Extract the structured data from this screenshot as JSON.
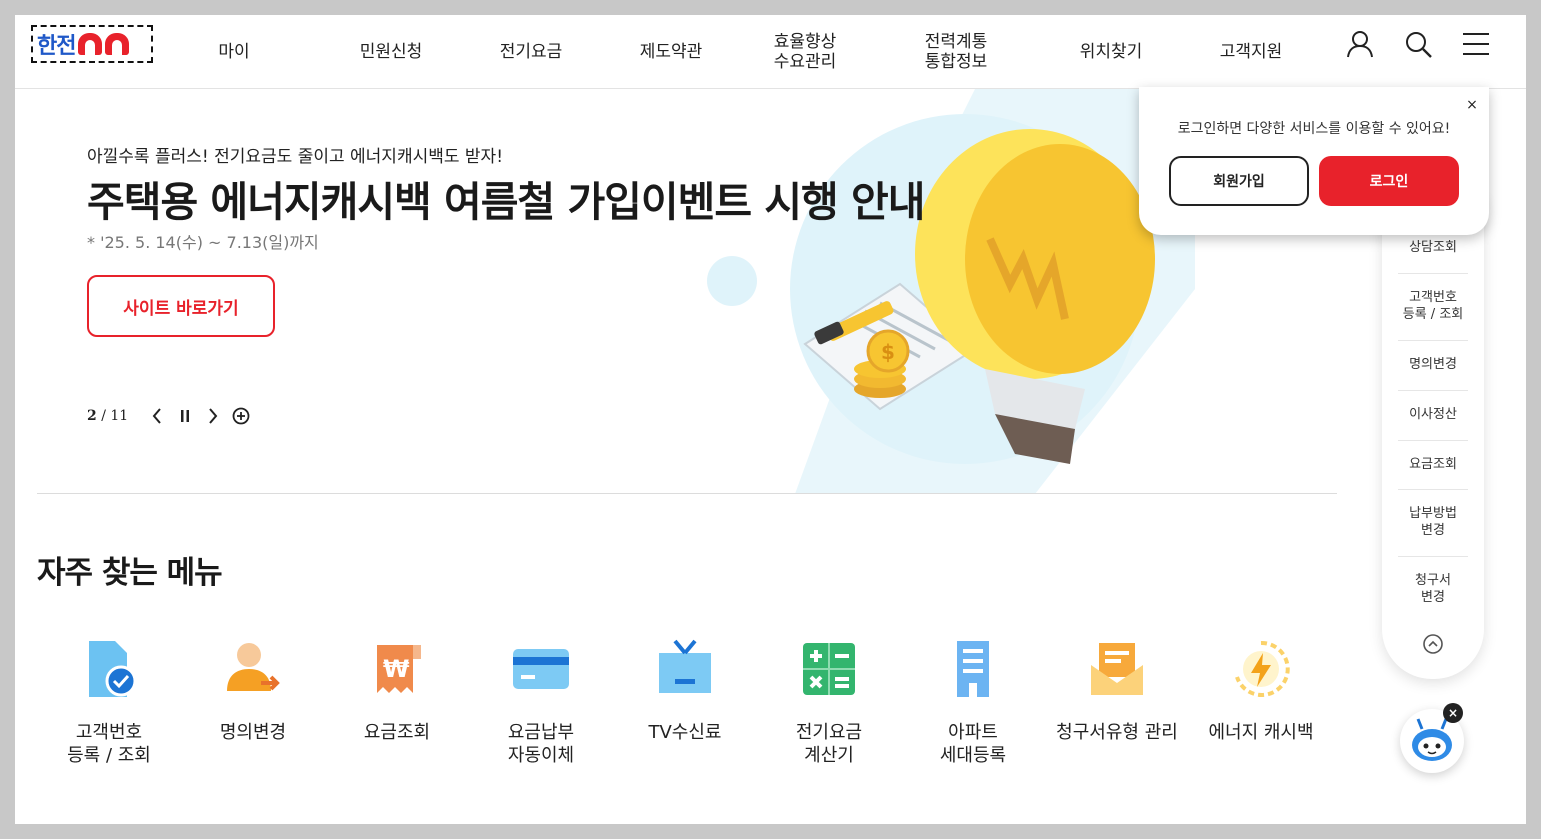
{
  "header": {
    "nav": [
      {
        "label": "마이"
      },
      {
        "label": "민원신청"
      },
      {
        "label": "전기요금"
      },
      {
        "label": "제도약관"
      },
      {
        "label": "효율향상\n수요관리"
      },
      {
        "label": "전력계통\n통합정보"
      },
      {
        "label": "위치찾기"
      },
      {
        "label": "고객지원"
      }
    ],
    "icons": [
      "user-icon",
      "search-icon",
      "menu-icon"
    ]
  },
  "hero": {
    "subtitle": "아낄수록 플러스! 전기요금도 줄이고 에너지캐시백도 받자!",
    "title": "주택용 에너지캐시백 여름철 가입이벤트 시행 안내",
    "period": "* '25. 5. 14(수) ~ 7.13(일)까지",
    "button_label": "사이트 바로가기",
    "pager": {
      "current": "2",
      "separator": "/",
      "total": "11"
    }
  },
  "frequent": {
    "title": "자주 찾는 메뉴",
    "items": [
      {
        "label": "고객번호\n등록 / 조회",
        "icon": "document-check-icon"
      },
      {
        "label": "명의변경",
        "icon": "person-transfer-icon"
      },
      {
        "label": "요금조회",
        "icon": "receipt-won-icon"
      },
      {
        "label": "요금납부\n자동이체",
        "icon": "credit-card-icon"
      },
      {
        "label": "TV수신료",
        "icon": "tv-icon"
      },
      {
        "label": "전기요금\n계산기",
        "icon": "calculator-icon"
      },
      {
        "label": "아파트\n세대등록",
        "icon": "apartment-icon"
      },
      {
        "label": "청구서유형 관리",
        "icon": "mail-icon"
      },
      {
        "label": "에너지 캐시백",
        "icon": "energy-cashback-icon"
      }
    ]
  },
  "quickbar": {
    "items": [
      {
        "label": "상담조회"
      },
      {
        "label": "고객번호\n등록 / 조회"
      },
      {
        "label": "명의변경"
      },
      {
        "label": "이사정산"
      },
      {
        "label": "요금조회"
      },
      {
        "label": "납부방법\n변경"
      },
      {
        "label": "청구서\n변경"
      }
    ]
  },
  "login_popup": {
    "message": "로그인하면 다양한 서비스를 이용할 수 있어요!",
    "join_label": "회원가입",
    "login_label": "로그인",
    "close_glyph": "×"
  },
  "chatbot": {
    "close_glyph": "×"
  },
  "colors": {
    "accent": "#e8222b",
    "brand_blue": "#1f58c8",
    "icon_blue": "#3aa6ea"
  }
}
